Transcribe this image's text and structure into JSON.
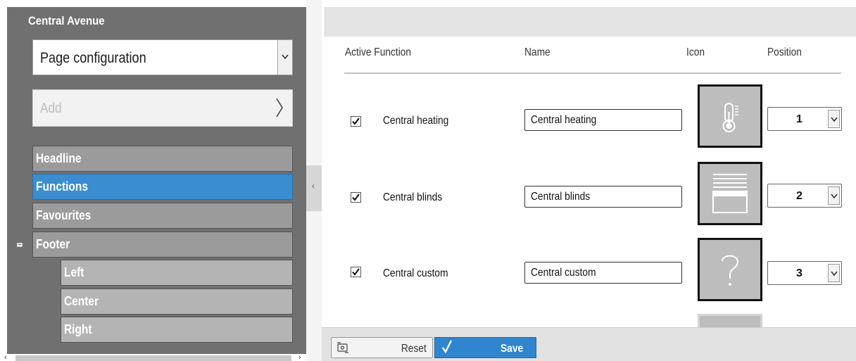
{
  "sidebar": {
    "title": "Central Avenue",
    "page_select": {
      "value": "Page configuration"
    },
    "add_label": "Add",
    "items": [
      {
        "label": "Headline"
      },
      {
        "label": "Functions",
        "active": true
      },
      {
        "label": "Favourites"
      },
      {
        "label": "Footer",
        "children": [
          {
            "label": "Left"
          },
          {
            "label": "Center"
          },
          {
            "label": "Right"
          }
        ]
      }
    ]
  },
  "main": {
    "columns": {
      "active_function": "Active Function",
      "name": "Name",
      "icon": "Icon",
      "position": "Position"
    },
    "rows": [
      {
        "active": true,
        "function": "Central heating",
        "name": "Central heating",
        "icon": "thermometer-icon",
        "position": "1"
      },
      {
        "active": true,
        "function": "Central blinds",
        "name": "Central blinds",
        "icon": "blinds-icon",
        "position": "2"
      },
      {
        "active": true,
        "function": "Central custom",
        "name": "Central custom",
        "icon": "question-mark-icon",
        "position": "3"
      }
    ]
  },
  "footer": {
    "reset_label": "Reset",
    "save_label": "Save"
  },
  "colors": {
    "accent": "#3a8dd0",
    "sidebar_bg": "#707070",
    "icon_tile": "#bdbdbd"
  }
}
